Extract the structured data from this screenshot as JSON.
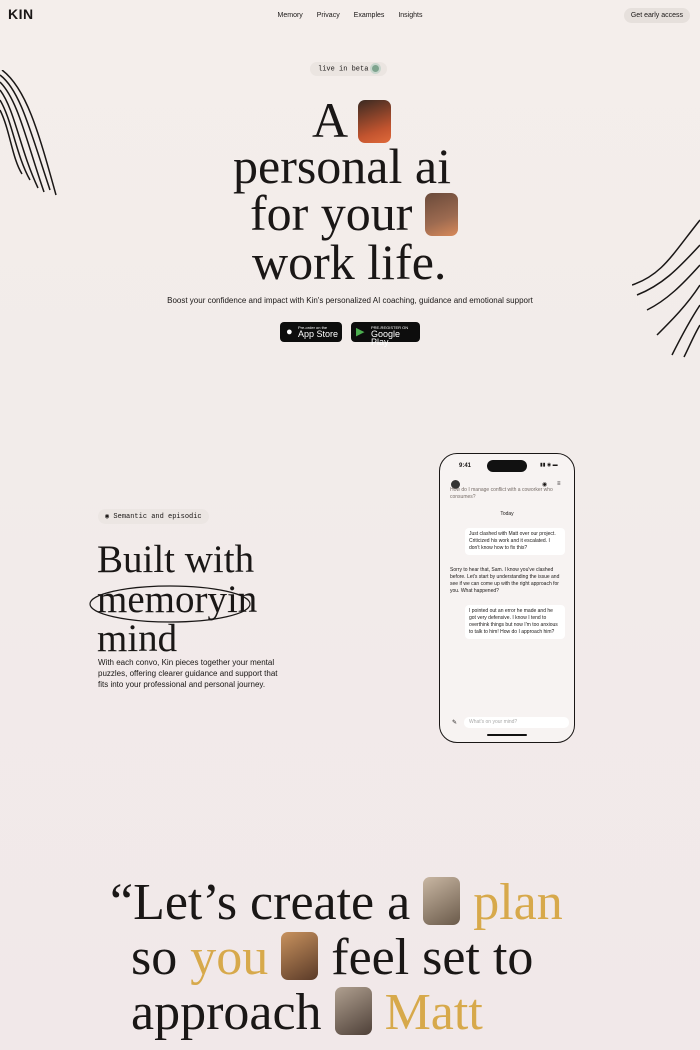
{
  "header": {
    "logo": "KIN",
    "nav": [
      "Memory",
      "Privacy",
      "Examples",
      "Insights"
    ],
    "cta": "Get early access"
  },
  "hero": {
    "badge": "live in beta",
    "line1": "A",
    "line2": "personal ai",
    "line3": "for your",
    "line4": "work life.",
    "subtitle": "Boost your confidence and impact with Kin's personalized AI coaching, guidance and emotional support",
    "app_store_small": "Pre-order on the",
    "app_store_big": "App Store",
    "play_small": "PRE-REGISTER ON",
    "play_big": "Google Play"
  },
  "feature": {
    "tag": "Semantic and episodic",
    "h_built": "Built with",
    "h_memory": "memory",
    "h_in": "in",
    "h_mind": "mind",
    "body": "With each convo, Kin pieces together your mental puzzles, offering clearer guidance and support that fits into your professional and personal journey."
  },
  "phone": {
    "time": "9:41",
    "top_msg": "How do I manage conflict with a coworker who consumes?",
    "day": "Today",
    "msg1": "Just clashed with Matt over our project. Criticized his work and it escalated. I don't know how to fix this?",
    "msg2": "Sorry to hear that, Sam. I know you've clashed before. Let's start by understanding the issue and see if we can come up with the right approach for you. What happened?",
    "msg3": "I pointed out an error he made and he got very defensive. I know I tend to overthink things but now I'm too anxious to talk to him! How do I approach him?",
    "input_placeholder": "What's on your mind?"
  },
  "quote": {
    "open": "“Let’s create a",
    "plan": "plan",
    "so": "so",
    "you": "you",
    "feel": "feel set to",
    "approach": "approach",
    "matt": "Matt"
  },
  "colors": {
    "accent": "#d7a94b",
    "bg": "#f3ecea",
    "dark": "#1a1716"
  }
}
